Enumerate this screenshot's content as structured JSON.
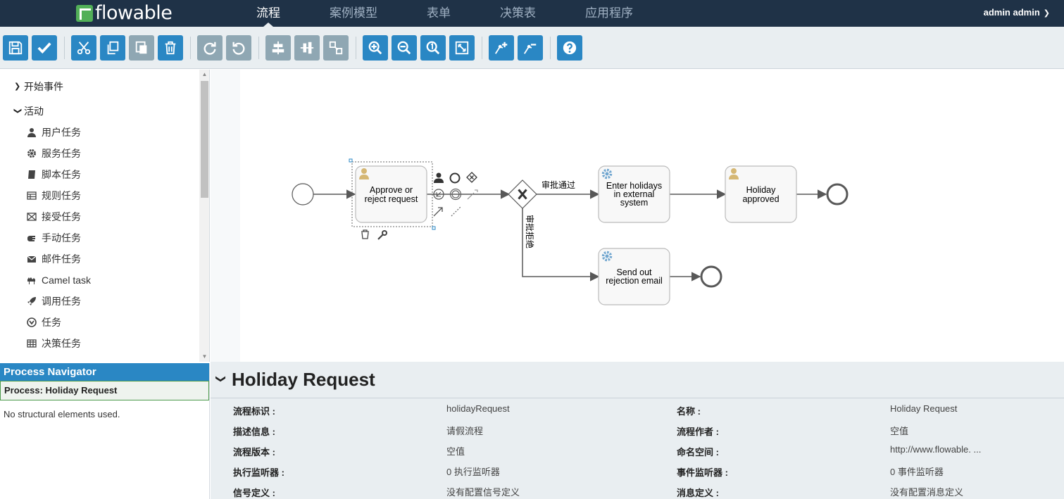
{
  "app": {
    "brand": "flowable",
    "brand_color": "#52b058",
    "nav_bg": "#1f3247"
  },
  "topnav": {
    "items": [
      {
        "label": "流程",
        "active": true
      },
      {
        "label": "案例模型",
        "active": false
      },
      {
        "label": "表单",
        "active": false
      },
      {
        "label": "决策表",
        "active": false
      },
      {
        "label": "应用程序",
        "active": false
      }
    ],
    "user": "admin admin"
  },
  "toolbar": {
    "buttons": [
      {
        "name": "save",
        "icon": "floppy-icon",
        "enabled": true
      },
      {
        "name": "validate",
        "icon": "check-icon",
        "enabled": true
      },
      {
        "name": "cut",
        "icon": "scissors-icon",
        "enabled": true
      },
      {
        "name": "copy",
        "icon": "copy-icon",
        "enabled": true
      },
      {
        "name": "paste",
        "icon": "paste-icon",
        "enabled": false
      },
      {
        "name": "delete",
        "icon": "trash-icon",
        "enabled": true
      },
      {
        "name": "redo",
        "icon": "redo-icon",
        "enabled": false
      },
      {
        "name": "undo",
        "icon": "undo-icon",
        "enabled": false
      },
      {
        "name": "align-horizontal",
        "icon": "align-horizontal-icon",
        "enabled": false
      },
      {
        "name": "align-vertical",
        "icon": "align-vertical-icon",
        "enabled": false
      },
      {
        "name": "same-size",
        "icon": "same-size-icon",
        "enabled": false
      },
      {
        "name": "zoom-in",
        "icon": "zoom-in-icon",
        "enabled": true
      },
      {
        "name": "zoom-out",
        "icon": "zoom-out-icon",
        "enabled": true
      },
      {
        "name": "zoom-actual",
        "icon": "zoom-actual-icon",
        "enabled": true
      },
      {
        "name": "zoom-fit",
        "icon": "zoom-fit-icon",
        "enabled": true
      },
      {
        "name": "add-bendpoint",
        "icon": "add-bendpoint-icon",
        "enabled": true
      },
      {
        "name": "remove-bendpoint",
        "icon": "remove-bendpoint-icon",
        "enabled": true
      },
      {
        "name": "help",
        "icon": "help-icon",
        "enabled": true
      }
    ]
  },
  "palette": {
    "groups": [
      {
        "label": "开始事件",
        "expanded": false
      },
      {
        "label": "活动",
        "expanded": true
      }
    ],
    "items": [
      {
        "label": "用户任务",
        "icon": "user-icon"
      },
      {
        "label": "服务任务",
        "icon": "gear-icon"
      },
      {
        "label": "脚本任务",
        "icon": "script-icon"
      },
      {
        "label": "规则任务",
        "icon": "table-icon"
      },
      {
        "label": "接受任务",
        "icon": "envelope-x-icon"
      },
      {
        "label": "手动任务",
        "icon": "hand-icon"
      },
      {
        "label": "邮件任务",
        "icon": "mail-icon"
      },
      {
        "label": "Camel task",
        "icon": "camel-icon"
      },
      {
        "label": "调用任务",
        "icon": "rocket-icon"
      },
      {
        "label": "任务",
        "icon": "flowable-icon"
      },
      {
        "label": "决策任务",
        "icon": "grid-icon"
      }
    ]
  },
  "navigator": {
    "title": "Process Navigator",
    "process": "Process: Holiday Request",
    "empty": "No structural elements used."
  },
  "diagram": {
    "tasks": {
      "approve": [
        "Approve or",
        "reject request"
      ],
      "enter": [
        "Enter holidays",
        "in external",
        "system"
      ],
      "approved": [
        "Holiday",
        "approved"
      ],
      "reject": [
        "Send out",
        "rejection email"
      ]
    },
    "flows": {
      "approve_label": "审批通过",
      "reject_label": "审批拒绝"
    }
  },
  "properties": {
    "title": "Holiday Request",
    "rows": [
      {
        "l1": "流程标识 :",
        "v1": "holidayRequest",
        "l2": "名称 :",
        "v2": "Holiday Request"
      },
      {
        "l1": "描述信息 :",
        "v1": "请假流程",
        "l2": "流程作者 :",
        "v2": "空值"
      },
      {
        "l1": "流程版本 :",
        "v1": "空值",
        "l2": "命名空间 :",
        "v2": "http://www.flowable. ..."
      },
      {
        "l1": "执行监听器 :",
        "v1": "0 执行监听器",
        "l2": "事件监听器 :",
        "v2": "0 事件监听器"
      },
      {
        "l1": "信号定义 :",
        "v1": "没有配置信号定义",
        "l2": "消息定义 :",
        "v2": "没有配置消息定义"
      }
    ]
  }
}
